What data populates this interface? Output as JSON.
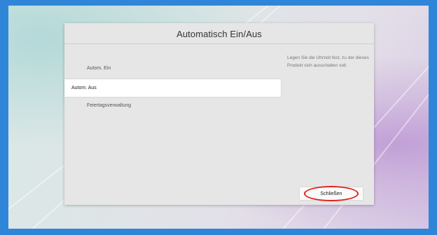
{
  "dialog": {
    "title": "Automatisch Ein/Aus",
    "menu_items": [
      {
        "label": "Autom. Ein",
        "selected": false
      },
      {
        "label": "Autom. Aus",
        "selected": true
      },
      {
        "label": "Feiertagsverwaltung",
        "selected": false
      }
    ],
    "help_text": "Legen Sie die Uhrzeit fest, zu der dieses Produkt sich ausschalten soll.",
    "close_label": "Schließen"
  },
  "colors": {
    "frame_border": "#2f86d8",
    "dialog_background": "#e6e6e6",
    "selected_item_background": "#ffffff",
    "highlight_ring": "#e0201c"
  }
}
